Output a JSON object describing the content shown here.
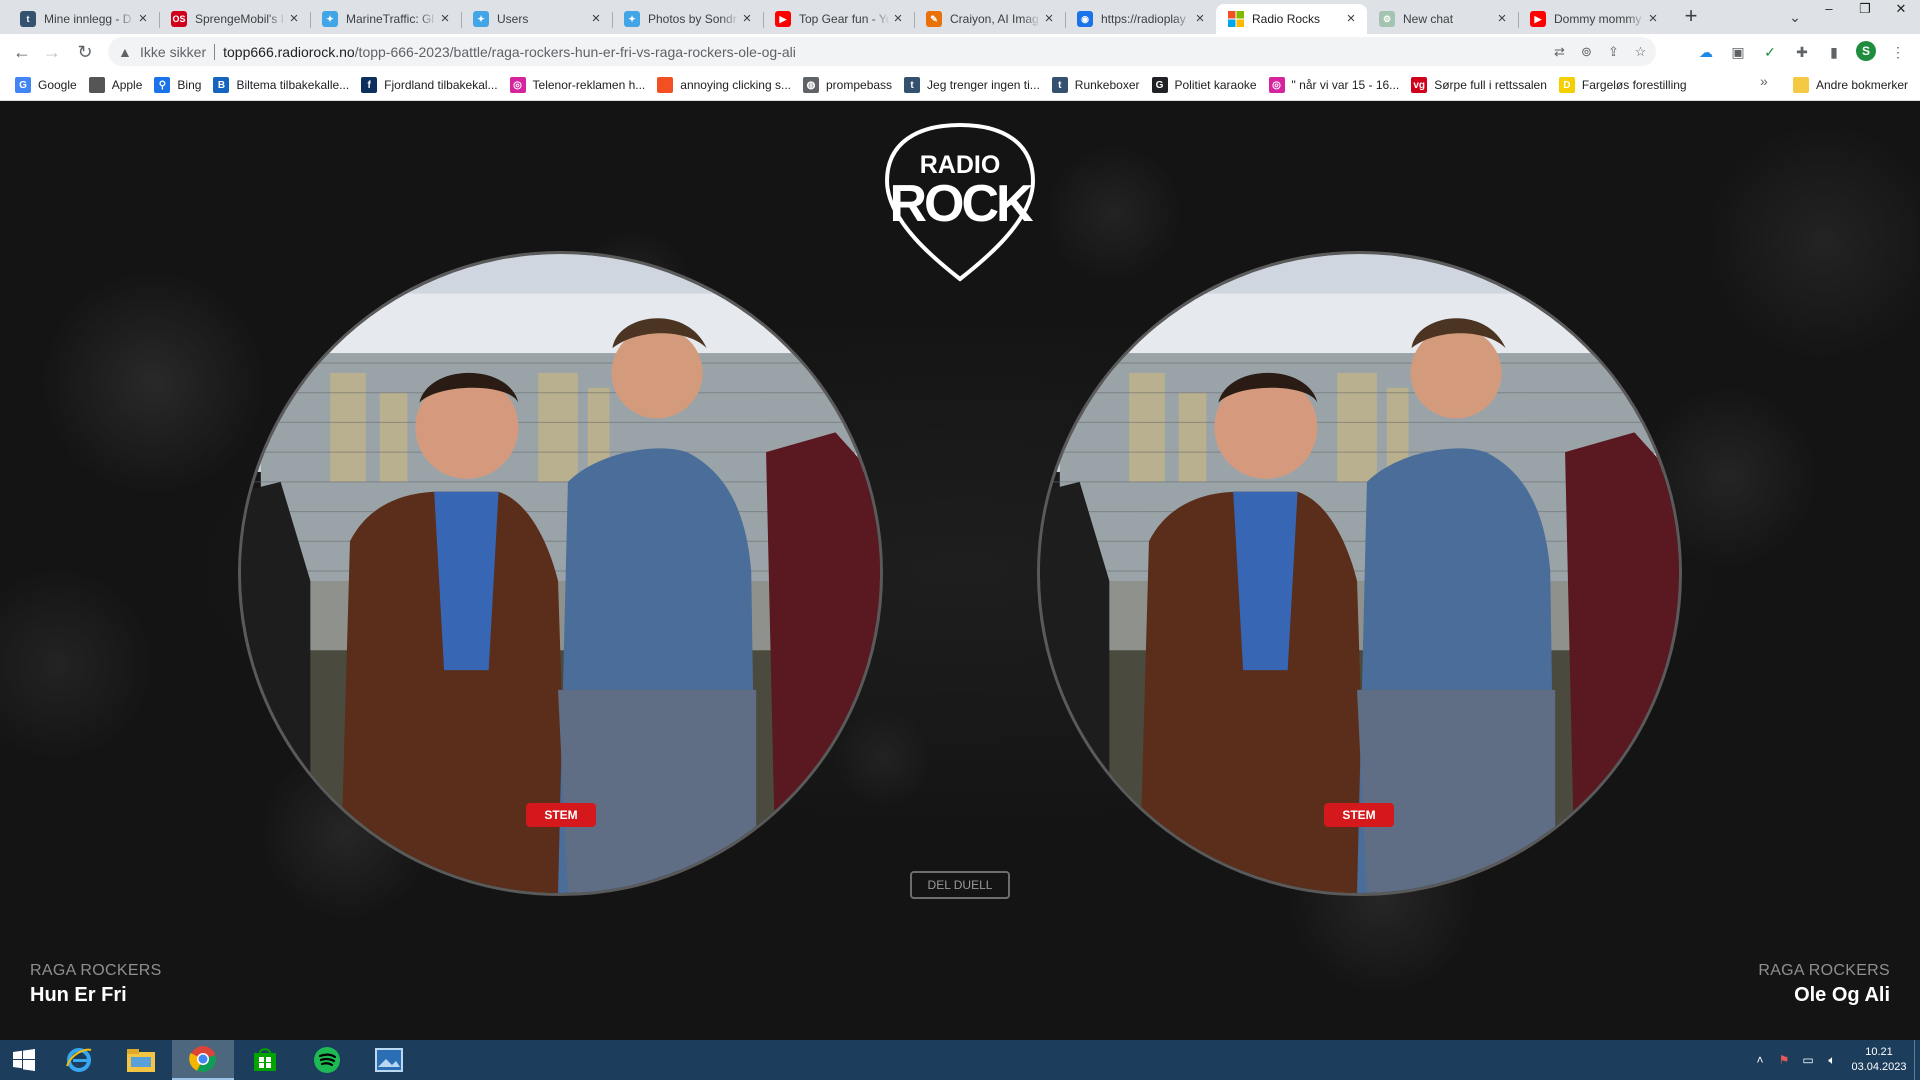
{
  "browser": {
    "tabs": [
      {
        "title": "Mine innlegg - D",
        "icon": "tumblr-icon",
        "color": "#34526f",
        "glyph": "t"
      },
      {
        "title": "SprengeMobil's I",
        "icon": "os-icon",
        "color": "#d0021b",
        "glyph": "OS"
      },
      {
        "title": "MarineTraffic: Gl",
        "icon": "feather-icon",
        "color": "#42a5e6",
        "glyph": "✦"
      },
      {
        "title": "Users",
        "icon": "feather-icon",
        "color": "#42a5e6",
        "glyph": "✦"
      },
      {
        "title": "Photos by Sondr",
        "icon": "feather-icon",
        "color": "#42a5e6",
        "glyph": "✦"
      },
      {
        "title": "Top Gear fun - Yo",
        "icon": "youtube-icon",
        "color": "#ff0000",
        "glyph": "▶"
      },
      {
        "title": "Craiyon, AI Imag",
        "icon": "pencil-icon",
        "color": "#e8710a",
        "glyph": "✎"
      },
      {
        "title": "https://radioplay",
        "icon": "page-icon",
        "color": "#1a73e8",
        "glyph": "◉"
      },
      {
        "title": "Radio Rocks",
        "icon": "windows-icon",
        "color": "#ffffff",
        "glyph": "",
        "active": true
      },
      {
        "title": "New chat",
        "icon": "chatgpt-icon",
        "color": "#a2c4b0",
        "glyph": "⚙"
      },
      {
        "title": "Dommy mommy",
        "icon": "youtube-icon",
        "color": "#ff0000",
        "glyph": "▶"
      }
    ],
    "not_secure": "Ikke sikker",
    "url_host": "topp666.radiorock.no",
    "url_path": "/topp-666-2023/battle/raga-rockers-hun-er-fri-vs-raga-rockers-ole-og-ali",
    "profile_initial": "S",
    "bookmarks": [
      {
        "label": "Google",
        "icon": "google-icon",
        "color": "#4285f4",
        "glyph": "G"
      },
      {
        "label": "Apple",
        "icon": "apple-icon",
        "color": "#555555",
        "glyph": ""
      },
      {
        "label": "Bing",
        "icon": "search-icon",
        "color": "#1a73e8",
        "glyph": "⚲"
      },
      {
        "label": "Biltema tilbakekalle...",
        "icon": "biltema-icon",
        "color": "#1565c0",
        "glyph": "B"
      },
      {
        "label": "Fjordland tilbakekal...",
        "icon": "fjordland-icon",
        "color": "#0d2f5e",
        "glyph": "f"
      },
      {
        "label": "Telenor-reklamen h...",
        "icon": "instagram-icon",
        "color": "#d6249f",
        "glyph": "◎"
      },
      {
        "label": "annoying clicking s...",
        "icon": "microsoft-icon",
        "color": "#f25022",
        "glyph": ""
      },
      {
        "label": "prompebass",
        "icon": "globe-icon",
        "color": "#5f6368",
        "glyph": "◍"
      },
      {
        "label": "Jeg trenger ingen ti...",
        "icon": "tumblr-icon",
        "color": "#34526f",
        "glyph": "t"
      },
      {
        "label": "Runkeboxer",
        "icon": "tumblr-icon",
        "color": "#34526f",
        "glyph": "t"
      },
      {
        "label": "Politiet karaoke",
        "icon": "google-icon",
        "color": "#202124",
        "glyph": "G"
      },
      {
        "label": "\" når vi var 15 - 16...",
        "icon": "instagram-icon",
        "color": "#d6249f",
        "glyph": "◎"
      },
      {
        "label": "Sørpe full i rettssalen",
        "icon": "vg-icon",
        "color": "#d0021b",
        "glyph": "vg"
      },
      {
        "label": "Fargeløs forestilling",
        "icon": "db-icon",
        "color": "#f4d000",
        "glyph": "D"
      }
    ],
    "other_bookmarks": "Andre bokmerker"
  },
  "page": {
    "logo_line1": "RADIO",
    "logo_line2": "ROCK",
    "vote_label": "STEM",
    "share_label": "DEL DUELL",
    "left_song": {
      "artist": "RAGA ROCKERS",
      "title": "Hun Er Fri"
    },
    "right_song": {
      "artist": "RAGA ROCKERS",
      "title": "Ole Og Ali"
    },
    "vote_color": "#d4181c"
  },
  "taskbar": {
    "time": "10.21",
    "date": "03.04.2023"
  }
}
